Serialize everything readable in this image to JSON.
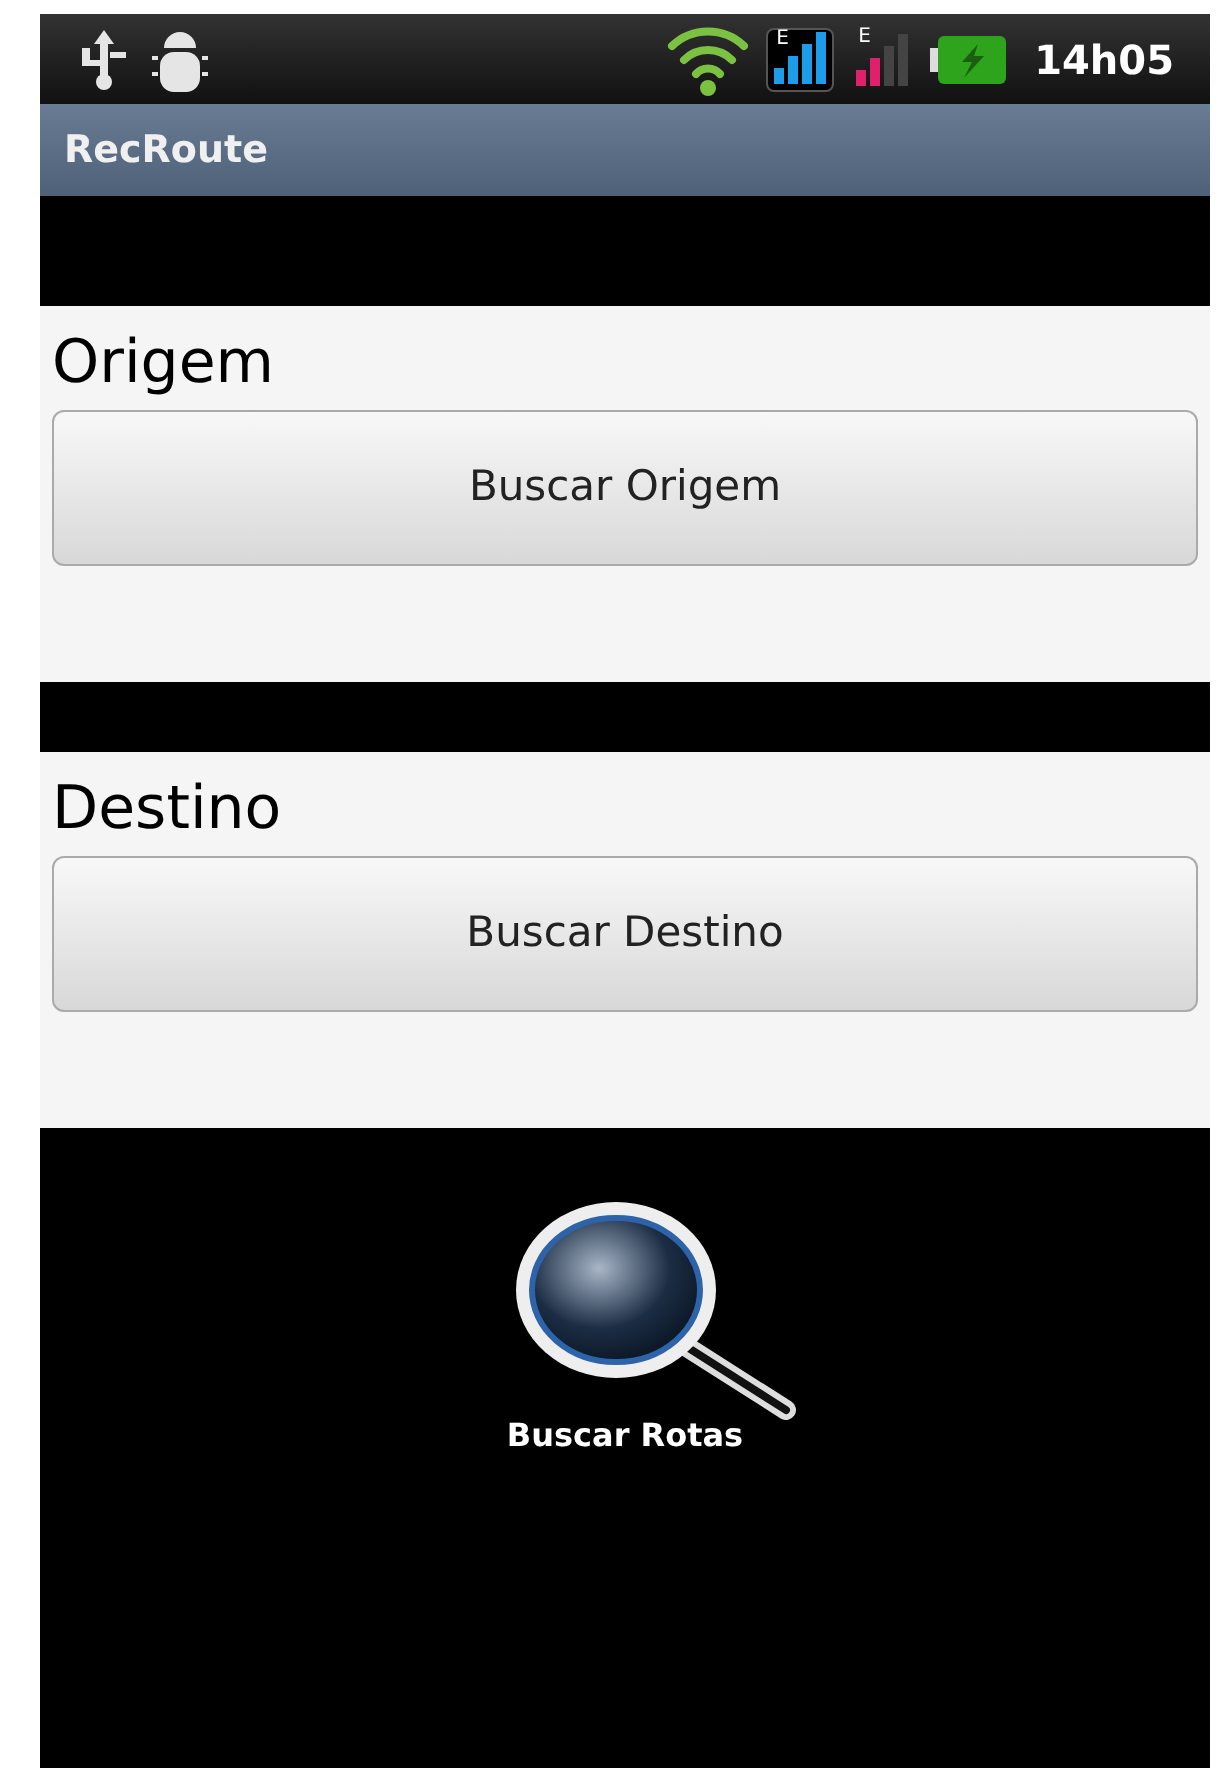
{
  "status_bar": {
    "time": "14h05",
    "network_labels": [
      "E",
      "E"
    ]
  },
  "title_bar": {
    "title": "RecRoute"
  },
  "sections": [
    {
      "label": "Origem",
      "button": "Buscar Origem"
    },
    {
      "label": "Destino",
      "button": "Buscar Destino"
    }
  ],
  "search_action": {
    "label": "Buscar Rotas"
  }
}
